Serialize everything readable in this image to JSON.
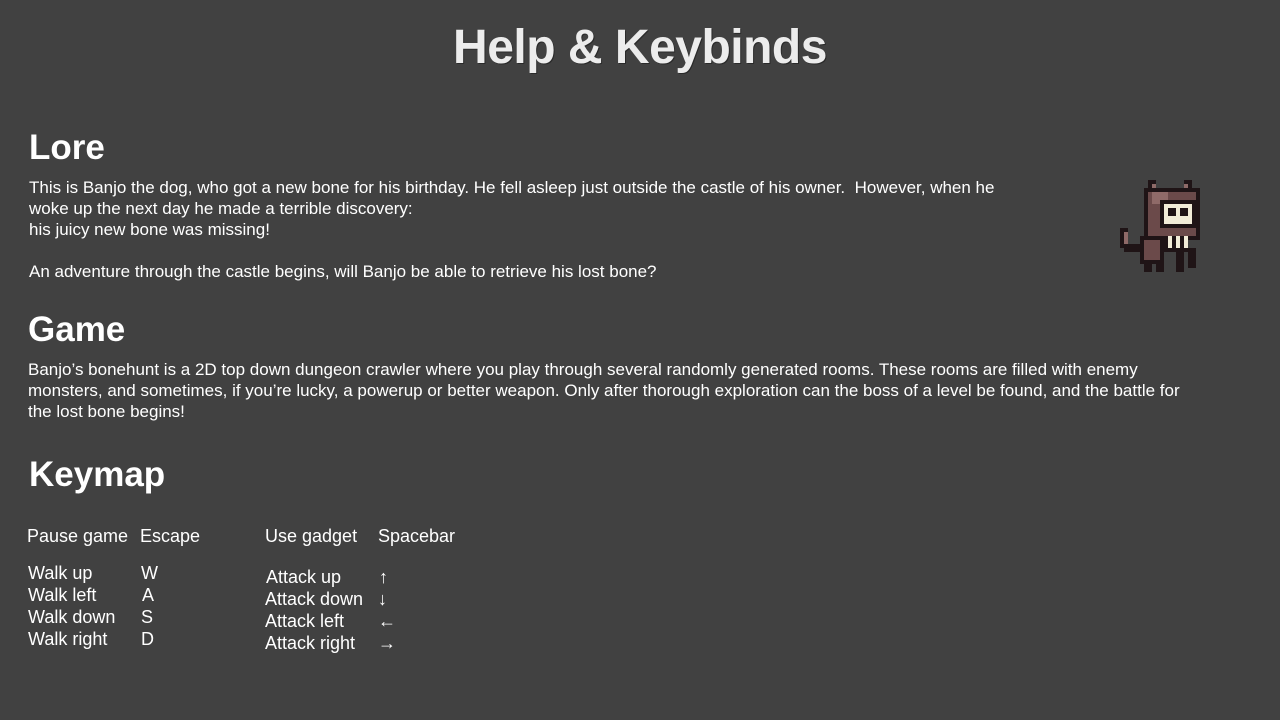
{
  "page": {
    "title": "Help & Keybinds"
  },
  "lore": {
    "heading": "Lore",
    "line1": "This is Banjo the dog, who got a new bone for his birthday. He fell asleep just outside the castle of his owner.  However, when he",
    "line2": "woke up the next day he made a terrible discovery:",
    "line3": "his juicy new bone was missing!",
    "line4": "An adventure through the castle begins, will Banjo be able to retrieve his lost bone?"
  },
  "game": {
    "heading": "Game",
    "line1": "Banjo’s bonehunt is a 2D top down dungeon crawler where you play through several randomly generated rooms. These rooms are filled with enemy",
    "line2": "monsters, and sometimes, if you’re lucky, a powerup or better weapon. Only after thorough exploration can the boss of a level be found, and the battle for",
    "line3": "the lost bone begins!"
  },
  "keymap": {
    "heading": "Keymap",
    "pause": {
      "label": "Pause game",
      "key": "Escape"
    },
    "gadget": {
      "label": "Use gadget",
      "key": "Spacebar"
    },
    "walk": [
      {
        "label": "Walk up",
        "key": "W"
      },
      {
        "label": "Walk left",
        "key": "A"
      },
      {
        "label": "Walk down",
        "key": "S"
      },
      {
        "label": "Walk right",
        "key": "D"
      }
    ],
    "attack": [
      {
        "label": "Attack up",
        "key": "↑"
      },
      {
        "label": "Attack down",
        "key": "↓"
      },
      {
        "label": "Attack left",
        "key": "←"
      },
      {
        "label": "Attack right",
        "key": "→"
      }
    ]
  },
  "sprite": {
    "icon": "banjo-dog-skull-sprite-icon",
    "colors": {
      "outline": "#1f1416",
      "fur": "#6b4a4a",
      "fur_light": "#8f6a68",
      "skull": "#f2ecd8",
      "collar": "#3a5a8a"
    }
  }
}
